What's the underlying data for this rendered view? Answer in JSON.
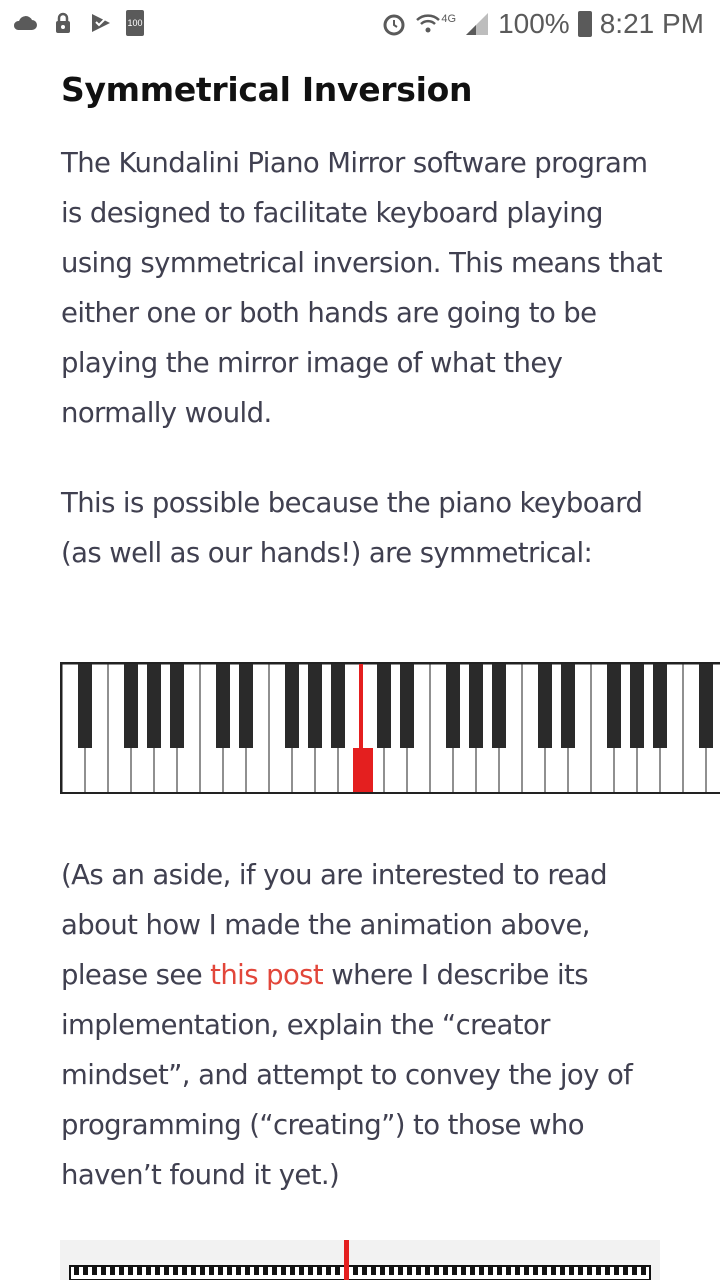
{
  "status_bar": {
    "left_icons": [
      "cloud-icon",
      "lock-icon",
      "app-icon",
      "battery-small-icon"
    ],
    "battery_small_label": "100",
    "network_label": "4G",
    "battery": "100%",
    "time": "8:21 PM"
  },
  "article": {
    "heading": "Symmetrical Inversion",
    "para1": "The Kundalini Piano Mirror software program is designed to facilitate keyboard playing using symmetrical inversion. This means that either one or both hands are going to be playing the mirror image of what they normally would.",
    "para2": "This is possible because the piano keyboard (as well as our hands!) are symmetrical:",
    "para3_before": "(As an aside, if you are interested to read about how I made the animation above, please see ",
    "para3_link": "this post",
    "para3_after": " where I describe its implementation, explain the “creator mindset”, and attempt to convey the joy of programming (“creating”) to those who haven’t found it yet.)"
  },
  "colors": {
    "accent_link": "#e2463a",
    "highlight_key": "#e41f1f"
  }
}
